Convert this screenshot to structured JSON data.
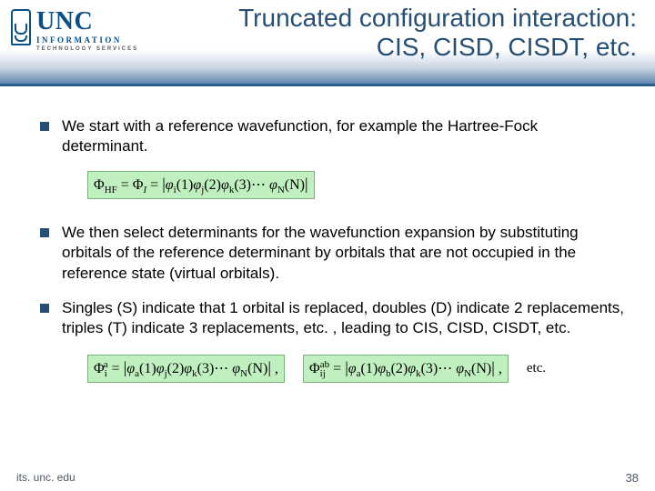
{
  "logo": {
    "word": "UNC",
    "sub1": "INFORMATION",
    "sub2": "TECHNOLOGY SERVICES"
  },
  "title": {
    "line1": "Truncated configuration interaction:",
    "line2": "CIS, CISD, CISDT, etc."
  },
  "bullets": {
    "b1": "We start with a reference wavefunction, for example the Hartree-Fock determinant.",
    "b2": "We then select determinants for the wavefunction expansion by substituting orbitals of the reference determinant by orbitals that are not occupied in the reference state (virtual orbitals).",
    "b3": "Singles (S) indicate that 1 orbital is replaced, doubles (D) indicate 2 replacements, triples (T) indicate 3 replacements, etc. , leading to CIS, CISD, CISDT, etc."
  },
  "equations": {
    "hf": "Φ_HF = Φ_I = |φ_i(1) φ_j(2) φ_k(3) ⋯ φ_N(N)|",
    "single": "Φ_i^a = |φ_a(1) φ_j(2) φ_k(3) ⋯ φ_N(N)| ,",
    "double": "Φ_ij^ab = |φ_a(1) φ_b(2) φ_k(3) ⋯ φ_N(N)| ,",
    "trailing": "etc."
  },
  "footer": {
    "url": "its. unc. edu",
    "page": "38"
  }
}
